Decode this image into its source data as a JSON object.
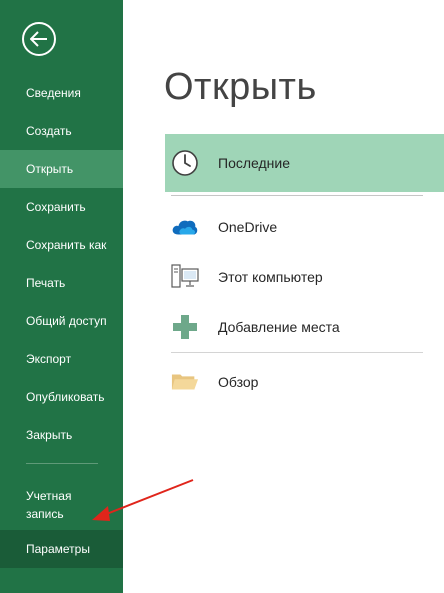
{
  "sidebar": {
    "back_icon": "arrow-left-icon",
    "colors": {
      "background": "#217346",
      "active": "#439467",
      "selected_bottom": "#1a5c38"
    },
    "items": [
      {
        "label": "Сведения"
      },
      {
        "label": "Создать"
      },
      {
        "label": "Открыть",
        "active": true
      },
      {
        "label": "Сохранить"
      },
      {
        "label": "Сохранить как"
      },
      {
        "label": "Печать"
      },
      {
        "label": "Общий доступ"
      },
      {
        "label": "Экспорт"
      },
      {
        "label": "Опубликовать"
      },
      {
        "label": "Закрыть"
      }
    ],
    "bottom_items": [
      {
        "label": "Учетная запись"
      },
      {
        "label": "Параметры",
        "highlighted": true
      }
    ]
  },
  "main": {
    "title": "Открыть",
    "locations": [
      {
        "label": "Последние",
        "icon": "clock-icon",
        "active": true
      },
      {
        "label": "OneDrive",
        "icon": "cloud-icon"
      },
      {
        "label": "Этот компьютер",
        "icon": "computer-icon"
      },
      {
        "label": "Добавление места",
        "icon": "plus-icon"
      },
      {
        "label": "Обзор",
        "icon": "folder-icon"
      }
    ],
    "active_color": "#9fd5b7"
  },
  "annotation": {
    "arrow_color": "#e0251b"
  }
}
